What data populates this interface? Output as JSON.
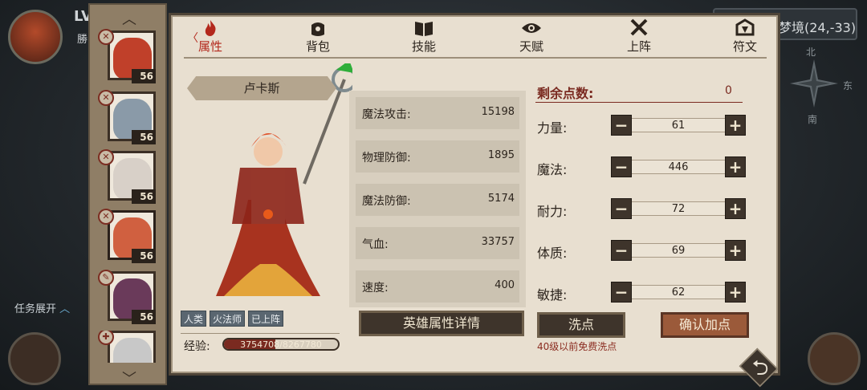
{
  "hud": {
    "level_text": "LV",
    "sub_text": "勝",
    "coord_text": "梦境(24,-33)",
    "compass": {
      "north": "北",
      "east": "东",
      "south": "南"
    },
    "task_toggle": "任务展开"
  },
  "roster": {
    "heroes": [
      {
        "level": "56",
        "color": "#c0402a"
      },
      {
        "level": "56",
        "color": "#8a9aa8"
      },
      {
        "level": "56",
        "color": "#d8d0c8"
      },
      {
        "level": "56",
        "color": "#d06040"
      },
      {
        "level": "56",
        "color": "#6a3a5a"
      },
      {
        "level": "",
        "color": "#c8c8c8"
      }
    ]
  },
  "tabs": [
    {
      "label": "属性",
      "icon": "flame-icon",
      "active": true
    },
    {
      "label": "背包",
      "icon": "bag-icon",
      "active": false
    },
    {
      "label": "技能",
      "icon": "book-icon",
      "active": false
    },
    {
      "label": "天赋",
      "icon": "eye-icon",
      "active": false
    },
    {
      "label": "上阵",
      "icon": "swords-icon",
      "active": false
    },
    {
      "label": "符文",
      "icon": "rune-icon",
      "active": false
    }
  ],
  "hero": {
    "name": "卢卡斯",
    "tags": [
      "人类",
      "火法师",
      "已上阵"
    ],
    "exp_label": "经验:",
    "exp_text": "3754708/8267780",
    "exp_fraction": 0.454
  },
  "stats": [
    {
      "label": "魔法攻击:",
      "value": "15198"
    },
    {
      "label": "物理防御:",
      "value": "1895"
    },
    {
      "label": "魔法防御:",
      "value": "5174"
    },
    {
      "label": "气血:",
      "value": "33757"
    },
    {
      "label": "速度:",
      "value": "400"
    }
  ],
  "detail_button": "英雄属性详情",
  "points": {
    "label": "剩余点数:",
    "value": "0"
  },
  "attributes": [
    {
      "label": "力量:",
      "value": "61"
    },
    {
      "label": "魔法:",
      "value": "446"
    },
    {
      "label": "耐力:",
      "value": "72"
    },
    {
      "label": "体质:",
      "value": "69"
    },
    {
      "label": "敏捷:",
      "value": "62"
    }
  ],
  "attr_minus": "−",
  "attr_plus": "+",
  "reset_button": "洗点",
  "free_note": "40级以前免费洗点",
  "confirm_button": "确认加点"
}
